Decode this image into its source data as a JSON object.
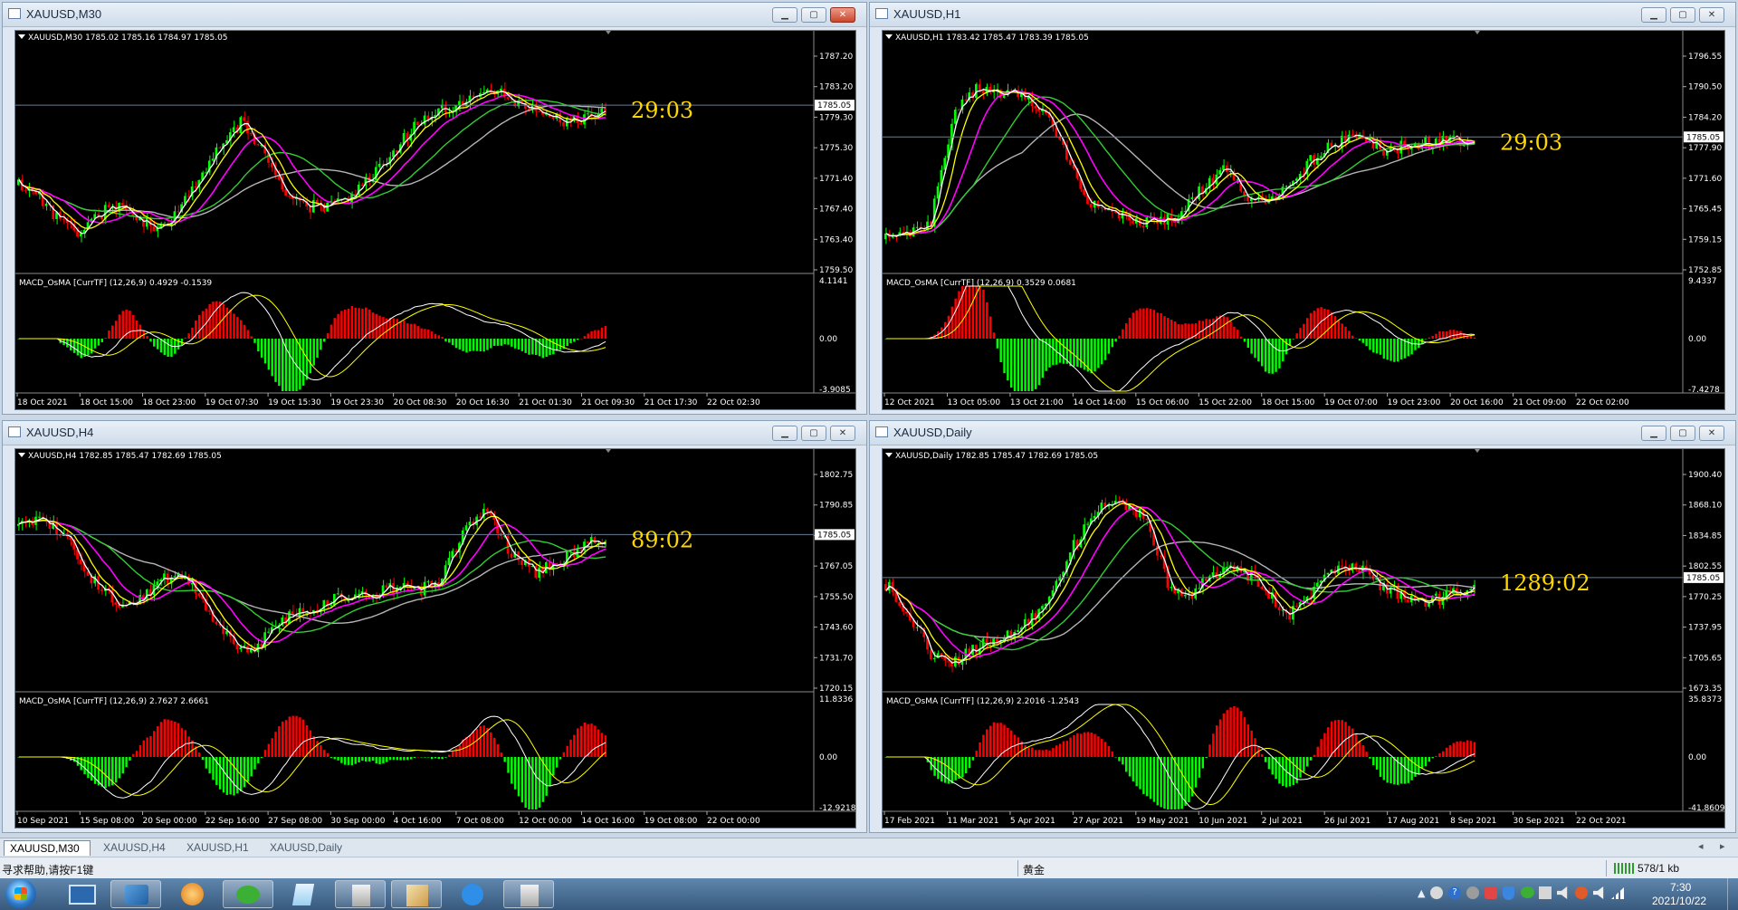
{
  "windows": [
    {
      "id": "m30",
      "title": "XAUUSD,M30",
      "header": "XAUUSD,M30  1785.02 1785.16 1784.97 1785.05",
      "countdown": "29:03",
      "price_labels": [
        "1787.20",
        "1783.20",
        "1779.30",
        "1775.30",
        "1771.40",
        "1767.40",
        "1763.40",
        "1759.50"
      ],
      "current_price": "1785.05",
      "macd_header": "MACD_OsMA [CurrTF] (12,26,9) 0.4929 -0.1539",
      "macd_labels": [
        "4.1141",
        "0.00",
        "-3.9085"
      ],
      "time_labels": [
        "18 Oct 2021",
        "18 Oct 15:00",
        "18 Oct 23:00",
        "19 Oct 07:30",
        "19 Oct 15:30",
        "19 Oct 23:30",
        "20 Oct 08:30",
        "20 Oct 16:30",
        "21 Oct 01:30",
        "21 Oct 09:30",
        "21 Oct 17:30",
        "22 Oct 02:30"
      ],
      "active": true
    },
    {
      "id": "h1",
      "title": "XAUUSD,H1",
      "header": "XAUUSD,H1  1783.42 1785.47 1783.39 1785.05",
      "countdown": "29:03",
      "price_labels": [
        "1796.55",
        "1790.50",
        "1784.20",
        "1777.90",
        "1771.60",
        "1765.45",
        "1759.15",
        "1752.85"
      ],
      "current_price": "1785.05",
      "macd_header": "MACD_OsMA [CurrTF] (12,26,9) 0.3529 0.0681",
      "macd_labels": [
        "9.4337",
        "0.00",
        "-7.4278"
      ],
      "time_labels": [
        "12 Oct 2021",
        "13 Oct 05:00",
        "13 Oct 21:00",
        "14 Oct 14:00",
        "15 Oct 06:00",
        "15 Oct 22:00",
        "18 Oct 15:00",
        "19 Oct 07:00",
        "19 Oct 23:00",
        "20 Oct 16:00",
        "21 Oct 09:00",
        "22 Oct 02:00"
      ],
      "active": false
    },
    {
      "id": "h4",
      "title": "XAUUSD,H4",
      "header": "XAUUSD,H4  1782.85 1785.47 1782.69 1785.05",
      "countdown": "89:02",
      "price_labels": [
        "1802.75",
        "1790.85",
        "1778.95",
        "1767.05",
        "1755.50",
        "1743.60",
        "1731.70",
        "1720.15"
      ],
      "current_price": "1785.05",
      "macd_header": "MACD_OsMA [CurrTF] (12,26,9) 2.7627 2.6661",
      "macd_labels": [
        "11.8336",
        "0.00",
        "-12.9218"
      ],
      "time_labels": [
        "10 Sep 2021",
        "15 Sep 08:00",
        "20 Sep 00:00",
        "22 Sep 16:00",
        "27 Sep 08:00",
        "30 Sep 00:00",
        "4 Oct 16:00",
        "7 Oct 08:00",
        "12 Oct 00:00",
        "14 Oct 16:00",
        "19 Oct 08:00",
        "22 Oct 00:00"
      ],
      "active": false
    },
    {
      "id": "d1",
      "title": "XAUUSD,Daily",
      "header": "XAUUSD,Daily  1782.85 1785.47 1782.69 1785.05",
      "countdown": "1289:02",
      "price_labels": [
        "1900.40",
        "1868.10",
        "1834.85",
        "1802.55",
        "1770.25",
        "1737.95",
        "1705.65",
        "1673.35"
      ],
      "current_price": "1785.05",
      "macd_header": "MACD_OsMA [CurrTF] (12,26,9) 2.2016 -1.2543",
      "macd_labels": [
        "35.8373",
        "0.00",
        "-41.8609"
      ],
      "time_labels": [
        "17 Feb 2021",
        "11 Mar 2021",
        "5 Apr 2021",
        "27 Apr 2021",
        "19 May 2021",
        "10 Jun 2021",
        "2 Jul 2021",
        "26 Jul 2021",
        "17 Aug 2021",
        "8 Sep 2021",
        "30 Sep 2021",
        "22 Oct 2021"
      ],
      "active": false
    }
  ],
  "bottom_tabs": [
    "XAUUSD,M30",
    "XAUUSD,H4",
    "XAUUSD,H1",
    "XAUUSD,Daily"
  ],
  "status": {
    "help_text": "寻求帮助,请按F1键",
    "profile": "黄金",
    "traffic": "578/1 kb"
  },
  "taskbar": {
    "time": "7:30",
    "date": "2021/10/22"
  },
  "colors": {
    "bull_candle": "#00ff00",
    "bear_candle": "#ff0000",
    "ma_white": "#ffffff",
    "ma_yellow": "#ffff00",
    "ma_magenta": "#ff00ff",
    "ma_green": "#32cd32",
    "ma_gray": "#b4b4b4",
    "countdown": "#ffd700"
  }
}
